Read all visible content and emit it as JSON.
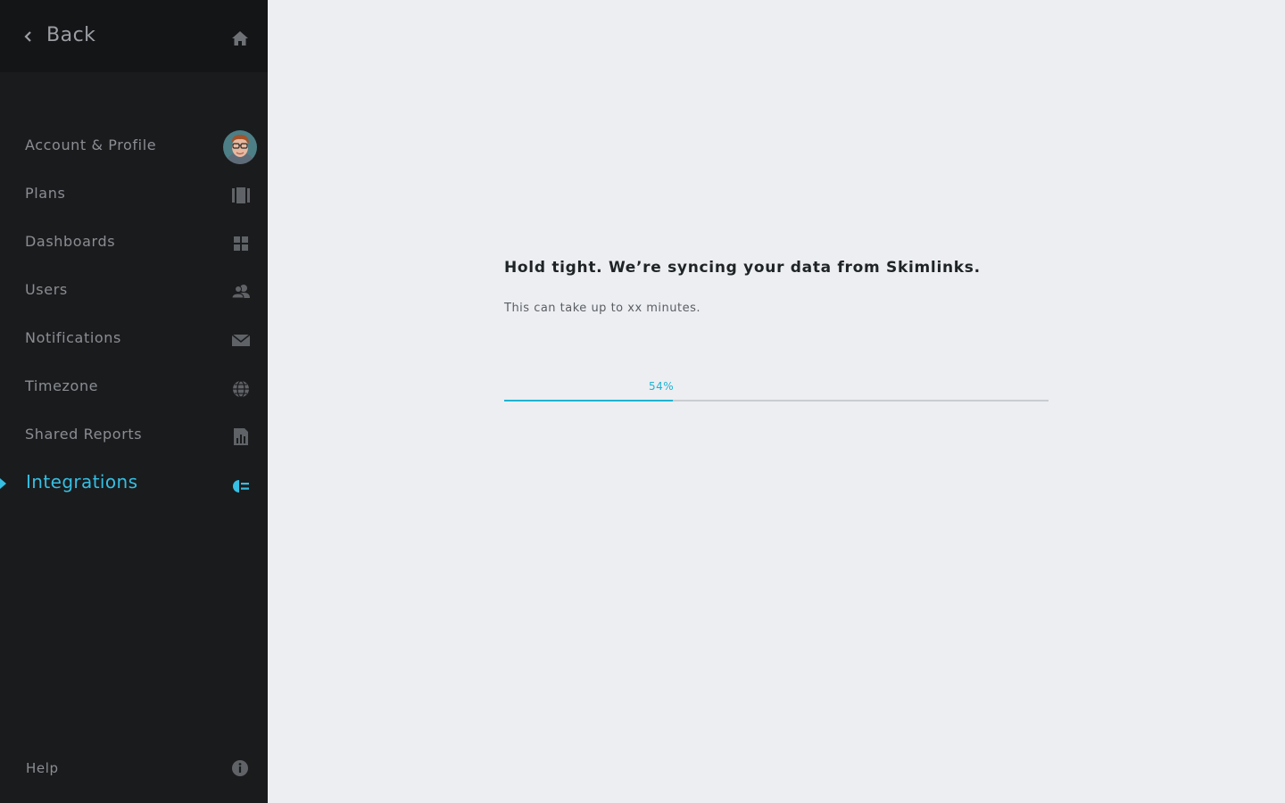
{
  "sidebar": {
    "back_label": "Back",
    "nav": [
      {
        "label": "Account & Profile",
        "icon": "avatar"
      },
      {
        "label": "Plans",
        "icon": "plans-icon"
      },
      {
        "label": "Dashboards",
        "icon": "dashboards-icon"
      },
      {
        "label": "Users",
        "icon": "users-icon"
      },
      {
        "label": "Notifications",
        "icon": "envelope-icon"
      },
      {
        "label": "Timezone",
        "icon": "globe-icon"
      },
      {
        "label": "Shared Reports",
        "icon": "report-icon"
      },
      {
        "label": "Integrations",
        "icon": "integrations-icon",
        "active": true
      }
    ],
    "help_label": "Help"
  },
  "main": {
    "title": "Hold tight. We’re syncing your data from Skimlinks.",
    "subtitle": "This can take up to xx minutes.",
    "progress": {
      "value": 0.31,
      "label": "54%"
    }
  },
  "colors": {
    "accent": "#35bfe3",
    "progress": "#1fb3d2",
    "sidebar_bg": "#1a1b1d",
    "main_bg": "#eceef2"
  }
}
